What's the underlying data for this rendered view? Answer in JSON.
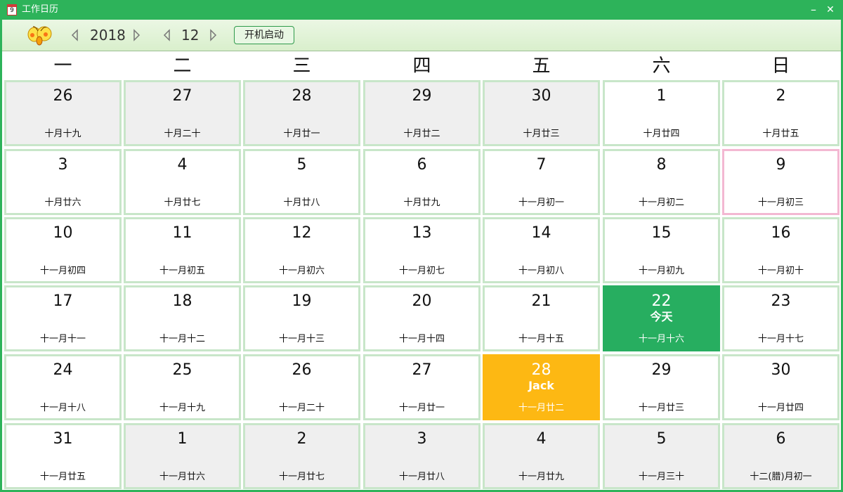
{
  "window": {
    "title": "工作日历",
    "icon_label": "9",
    "minimize": "–",
    "close": "✕"
  },
  "toolbar": {
    "year": "2018",
    "month": "12",
    "autostart_label": "开机启动"
  },
  "weekdays": [
    "一",
    "二",
    "三",
    "四",
    "五",
    "六",
    "日"
  ],
  "colors": {
    "accent": "#2db35a",
    "today": "#27ae60",
    "event": "#fdb813",
    "cell_border": "#c8e6c9",
    "other_month": "#efefef",
    "highlight_border": "#f3b8d2"
  },
  "days": [
    {
      "day": "26",
      "lunar": "十月十九",
      "other": true
    },
    {
      "day": "27",
      "lunar": "十月二十",
      "other": true
    },
    {
      "day": "28",
      "lunar": "十月廿一",
      "other": true
    },
    {
      "day": "29",
      "lunar": "十月廿二",
      "other": true
    },
    {
      "day": "30",
      "lunar": "十月廿三",
      "other": true
    },
    {
      "day": "1",
      "lunar": "十月廿四"
    },
    {
      "day": "2",
      "lunar": "十月廿五"
    },
    {
      "day": "3",
      "lunar": "十月廿六"
    },
    {
      "day": "4",
      "lunar": "十月廿七"
    },
    {
      "day": "5",
      "lunar": "十月廿八"
    },
    {
      "day": "6",
      "lunar": "十月廿九"
    },
    {
      "day": "7",
      "lunar": "十一月初一"
    },
    {
      "day": "8",
      "lunar": "十一月初二"
    },
    {
      "day": "9",
      "lunar": "十一月初三",
      "highlight": true
    },
    {
      "day": "10",
      "lunar": "十一月初四"
    },
    {
      "day": "11",
      "lunar": "十一月初五"
    },
    {
      "day": "12",
      "lunar": "十一月初六"
    },
    {
      "day": "13",
      "lunar": "十一月初七"
    },
    {
      "day": "14",
      "lunar": "十一月初八"
    },
    {
      "day": "15",
      "lunar": "十一月初九"
    },
    {
      "day": "16",
      "lunar": "十一月初十"
    },
    {
      "day": "17",
      "lunar": "十一月十一"
    },
    {
      "day": "18",
      "lunar": "十一月十二"
    },
    {
      "day": "19",
      "lunar": "十一月十三"
    },
    {
      "day": "20",
      "lunar": "十一月十四"
    },
    {
      "day": "21",
      "lunar": "十一月十五"
    },
    {
      "day": "22",
      "lunar": "十一月十六",
      "today": true,
      "note": "今天"
    },
    {
      "day": "23",
      "lunar": "十一月十七"
    },
    {
      "day": "24",
      "lunar": "十一月十八"
    },
    {
      "day": "25",
      "lunar": "十一月十九"
    },
    {
      "day": "26",
      "lunar": "十一月二十"
    },
    {
      "day": "27",
      "lunar": "十一月廿一"
    },
    {
      "day": "28",
      "lunar": "十一月廿二",
      "event": true,
      "note": "Jack"
    },
    {
      "day": "29",
      "lunar": "十一月廿三"
    },
    {
      "day": "30",
      "lunar": "十一月廿四"
    },
    {
      "day": "31",
      "lunar": "十一月廿五"
    },
    {
      "day": "1",
      "lunar": "十一月廿六",
      "other": true
    },
    {
      "day": "2",
      "lunar": "十一月廿七",
      "other": true
    },
    {
      "day": "3",
      "lunar": "十一月廿八",
      "other": true
    },
    {
      "day": "4",
      "lunar": "十一月廿九",
      "other": true
    },
    {
      "day": "5",
      "lunar": "十一月三十",
      "other": true
    },
    {
      "day": "6",
      "lunar": "十二(腊)月初一",
      "other": true
    }
  ]
}
